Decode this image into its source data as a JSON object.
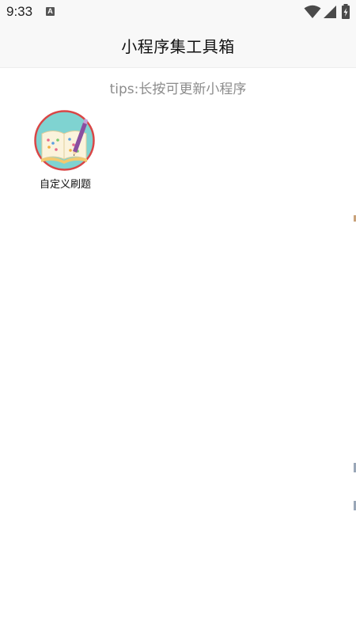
{
  "status_bar": {
    "time": "9:33",
    "notification_icon": "A",
    "icons": [
      "notification-icon",
      "wifi-icon",
      "signal-icon",
      "battery-icon"
    ]
  },
  "app_bar": {
    "title": "小程序集工具箱"
  },
  "main": {
    "tips": "tips:长按可更新小程序",
    "apps": [
      {
        "label": "自定义刷题",
        "icon": "book-pen-icon"
      }
    ]
  },
  "colors": {
    "status_bg": "#f8f8f8",
    "appbar_bg": "#f8f8f8",
    "tips_text": "#8c8c8c",
    "icon_ring": "#d94646",
    "icon_bg": "#7fd3d1"
  }
}
